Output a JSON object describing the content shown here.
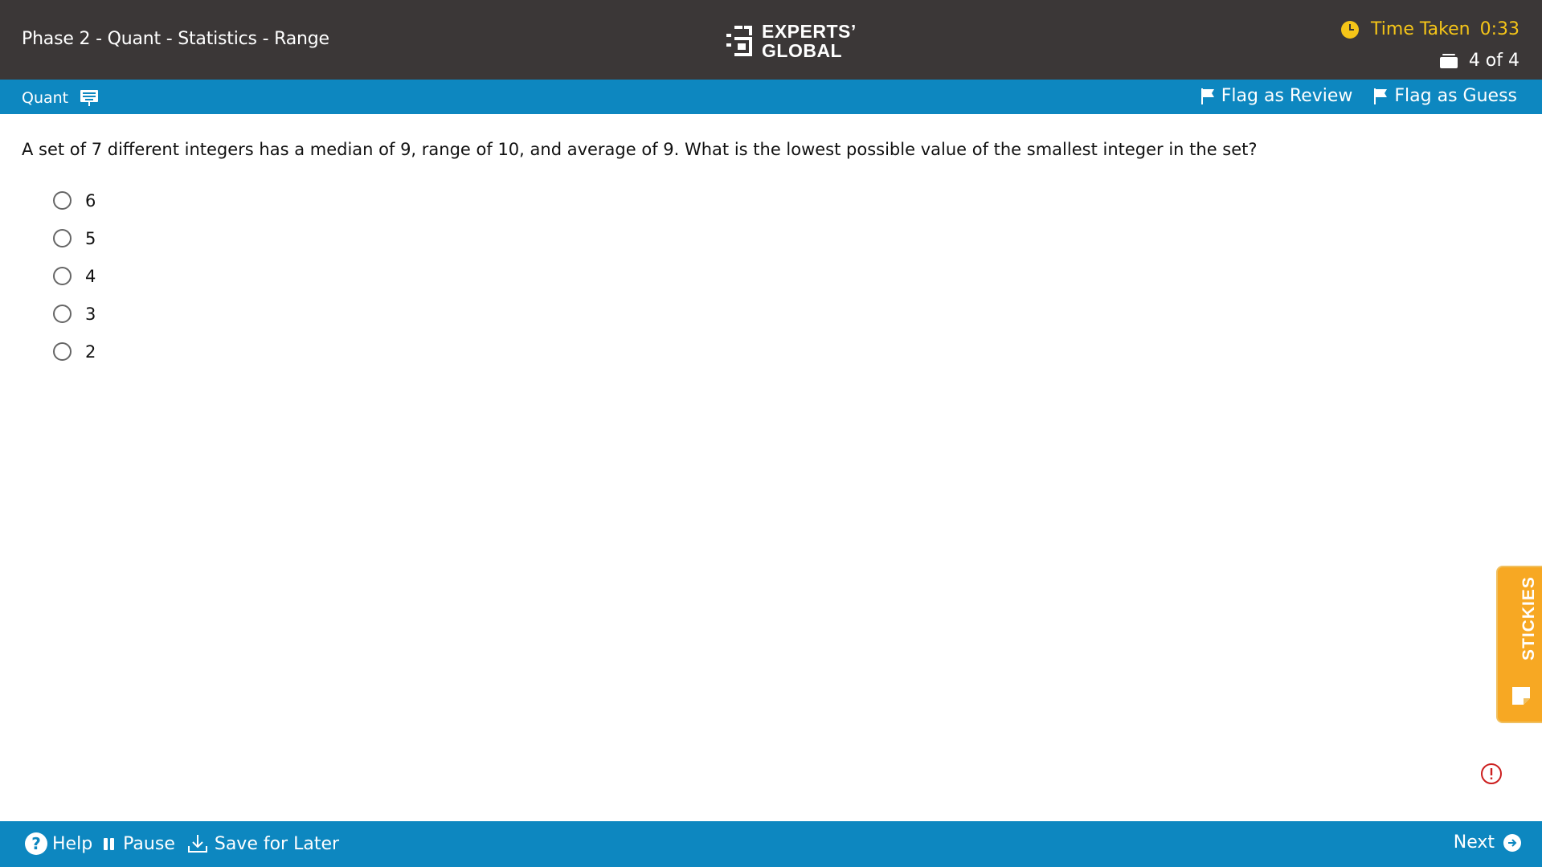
{
  "header": {
    "title": "Phase 2 - Quant - Statistics - Range",
    "logo_line1": "EXPERTS’",
    "logo_line2": "GLOBAL",
    "timer_label": "Time Taken",
    "timer_value": "0:33",
    "progress": "4 of 4"
  },
  "subheader": {
    "section": "Quant",
    "flag_review": "Flag as Review",
    "flag_guess": "Flag as Guess"
  },
  "question": {
    "text": "A set of 7 different integers has a median of 9, range of 10, and average of 9. What is the lowest possible value of the smallest integer in the set?",
    "options": [
      "6",
      "5",
      "4",
      "3",
      "2"
    ]
  },
  "sidebar": {
    "stickies_label": "STICKIES"
  },
  "footer": {
    "help": "Help",
    "pause": "Pause",
    "save_for_later": "Save for Later",
    "next": "Next"
  },
  "colors": {
    "header_bg": "#3b3737",
    "accent_blue": "#0d87c0",
    "timer_yellow": "#f5c518",
    "stickies_orange": "#f7a823",
    "alert_red": "#cc1f1f"
  },
  "icons": [
    "calculator-icon",
    "clock-icon",
    "question-stack-icon",
    "flag-icon",
    "help-icon",
    "pause-icon",
    "download-icon",
    "next-arrow-icon",
    "sticky-note-icon",
    "alert-icon"
  ]
}
